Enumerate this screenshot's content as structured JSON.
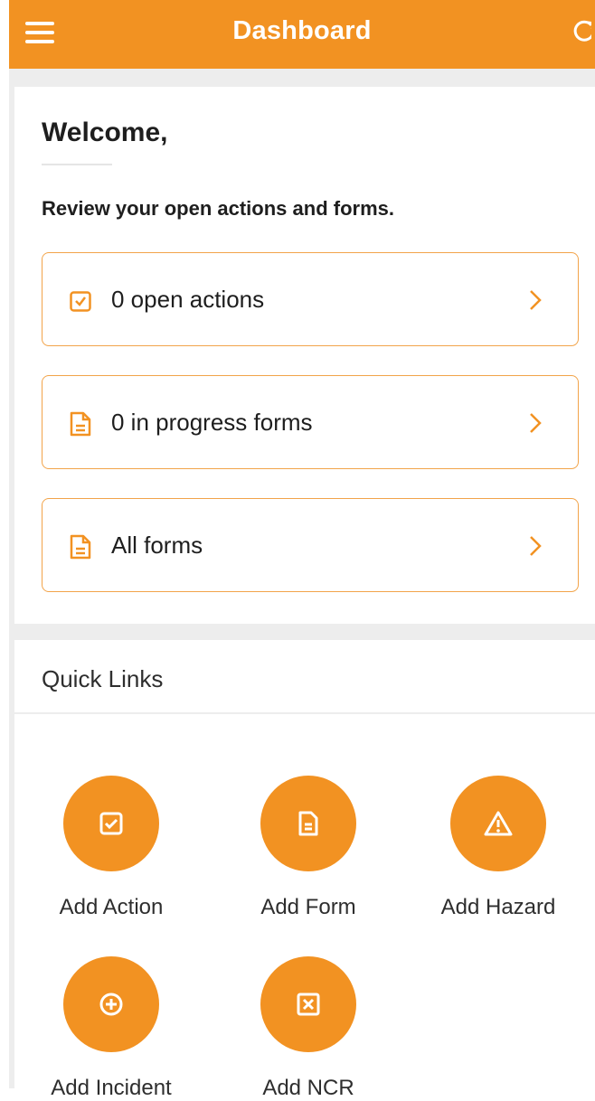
{
  "header": {
    "title": "Dashboard"
  },
  "welcome": {
    "title": "Welcome,",
    "subtitle": "Review your open actions and forms."
  },
  "links": [
    {
      "label": "0 open actions",
      "icon": "checkbox-icon"
    },
    {
      "label": "0 in progress forms",
      "icon": "document-icon"
    },
    {
      "label": "All forms",
      "icon": "document-icon"
    }
  ],
  "quick_links": {
    "title": "Quick Links",
    "items": [
      {
        "label": "Add Action",
        "icon": "checkbox-icon"
      },
      {
        "label": "Add Form",
        "icon": "document-icon"
      },
      {
        "label": "Add Hazard",
        "icon": "warning-icon"
      },
      {
        "label": "Add Incident",
        "icon": "plus-circle-icon"
      },
      {
        "label": "Add NCR",
        "icon": "x-box-icon"
      }
    ]
  },
  "colors": {
    "accent": "#f29222",
    "link_border": "#f2a44a"
  }
}
